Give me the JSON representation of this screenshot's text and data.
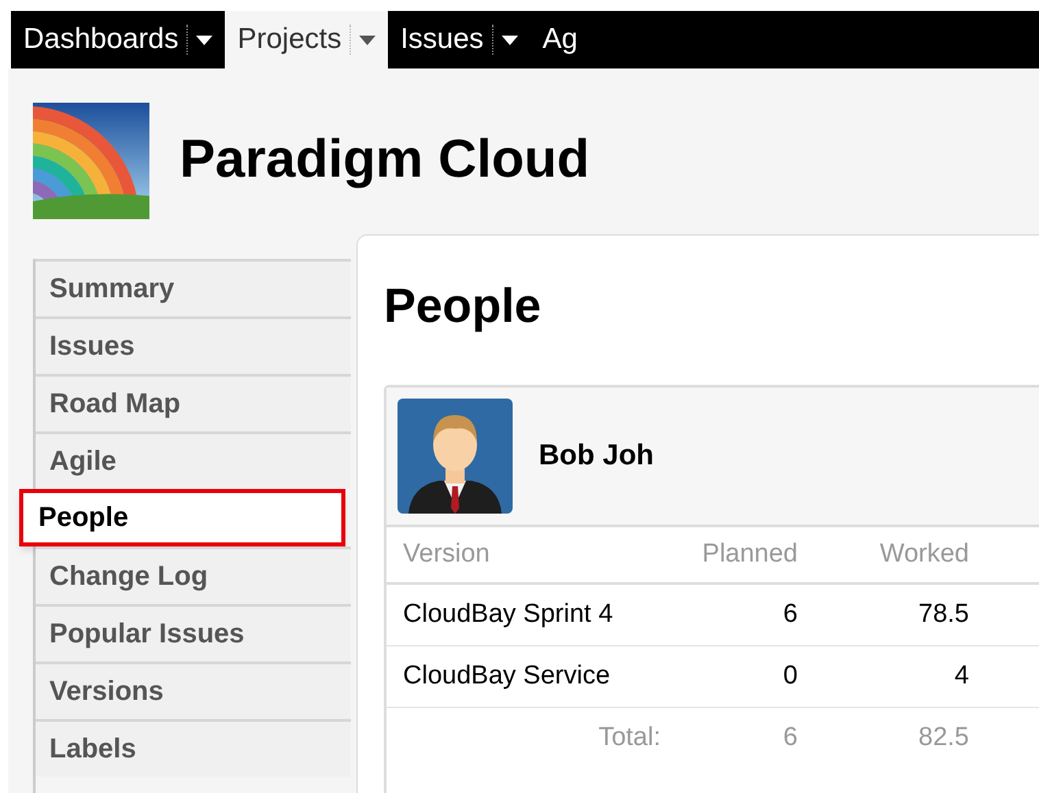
{
  "nav": [
    {
      "label": "Dashboards",
      "selected": false,
      "dropdown": true
    },
    {
      "label": "Projects",
      "selected": true,
      "dropdown": true
    },
    {
      "label": "Issues",
      "selected": false,
      "dropdown": true
    },
    {
      "label": "Ag",
      "selected": false,
      "dropdown": false
    }
  ],
  "project": {
    "title": "Paradigm Cloud"
  },
  "sidebar": {
    "items": [
      {
        "label": "Summary",
        "selected": false
      },
      {
        "label": "Issues",
        "selected": false
      },
      {
        "label": "Road Map",
        "selected": false
      },
      {
        "label": "Agile",
        "selected": false
      },
      {
        "label": "People",
        "selected": true
      },
      {
        "label": "Change Log",
        "selected": false
      },
      {
        "label": "Popular Issues",
        "selected": false
      },
      {
        "label": "Versions",
        "selected": false
      },
      {
        "label": "Labels",
        "selected": false
      }
    ]
  },
  "main": {
    "title": "People",
    "person": {
      "name": "Bob Joh",
      "table": {
        "columns": [
          "Version",
          "Planned",
          "Worked"
        ],
        "rows": [
          [
            "CloudBay Sprint 4",
            "6",
            "78.5"
          ],
          [
            "CloudBay Service",
            "0",
            "4"
          ]
        ],
        "total": {
          "label": "Total:",
          "planned": "6",
          "worked": "82.5"
        }
      }
    }
  }
}
